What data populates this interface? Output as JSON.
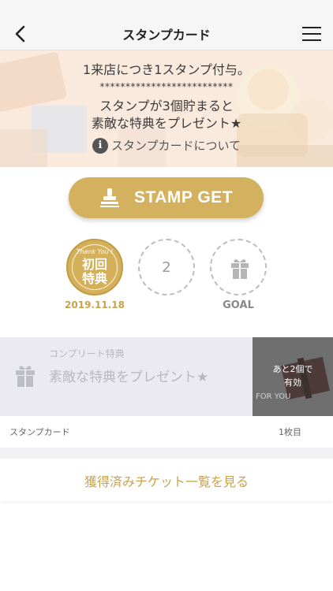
{
  "header": {
    "title": "スタンプカード",
    "back_icon": "chevron-left-icon",
    "menu_icon": "hamburger-menu-icon"
  },
  "hero": {
    "line1": "1来店につき1スタンプ付与。",
    "stars": "**************************",
    "line2": "スタンプが3個貯まると",
    "line3": "素敵な特典をプレゼント★",
    "about_label": "スタンプカードについて",
    "about_icon": "info-icon"
  },
  "stamp_button": {
    "label": "STAMP GET",
    "icon": "stamp-icon"
  },
  "stamps": [
    {
      "status": "done",
      "top_text": "Thank You !",
      "line1": "初回",
      "line2": "特典",
      "date": "2019.11.18"
    },
    {
      "status": "empty",
      "number": "2"
    },
    {
      "status": "goal",
      "icon": "gift-icon",
      "label": "GOAL"
    }
  ],
  "reward": {
    "caption": "コンプリート特典",
    "name": "素敵な特典をプレゼント★",
    "badge_line1": "あと2個で",
    "badge_line2": "有効",
    "photo_text": "FOR YOU"
  },
  "card_bar": {
    "left": "スタンプカード",
    "right": "1枚目"
  },
  "tickets_link": "獲得済みチケット一覧を見る",
  "colors": {
    "gold": "#d3b15f",
    "gold_text": "#c9a24d",
    "nav_bg": "#f6f6f6"
  }
}
